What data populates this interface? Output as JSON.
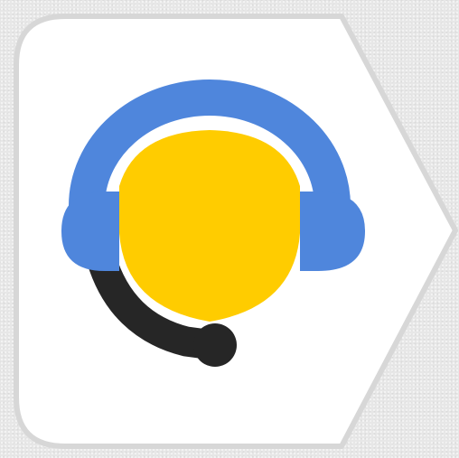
{
  "app_icon": {
    "icon": "headset-support-icon",
    "colors": {
      "page_background": "#e7e7e7",
      "tile_background": "#ffffff",
      "tile_border": "#d7d7d7",
      "headband": "#4f86dc",
      "face": "#ffcc00",
      "microphone": "#262626"
    }
  }
}
